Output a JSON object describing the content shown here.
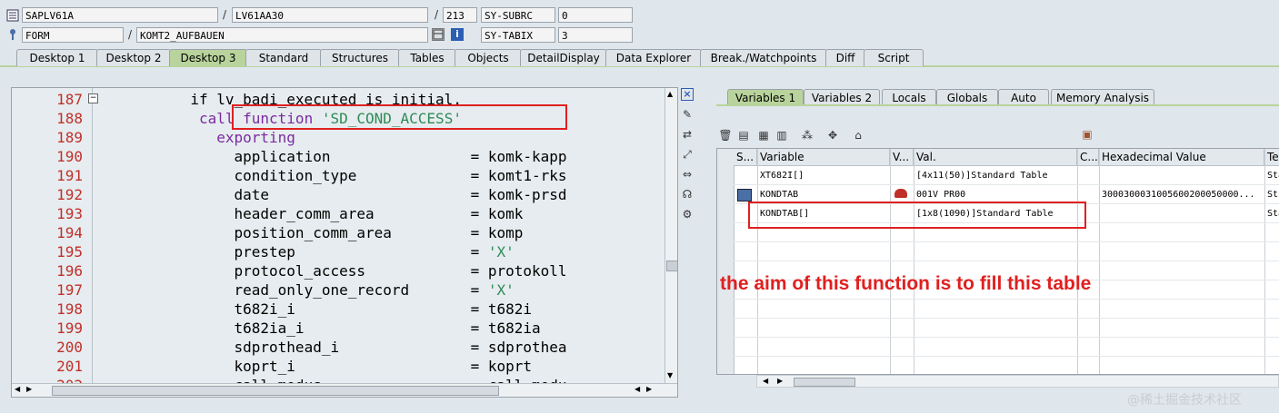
{
  "header": {
    "program": "SAPLV61A",
    "include": "LV61AA30",
    "line": "213",
    "subrc_label": "SY-SUBRC",
    "subrc_value": "0",
    "event_type": "FORM",
    "event_name": "KOMT2_AUFBAUEN",
    "tabix_label": "SY-TABIX",
    "tabix_value": "3",
    "sep": "/"
  },
  "tabs": [
    "Desktop 1",
    "Desktop 2",
    "Desktop 3",
    "Standard",
    "Structures",
    "Tables",
    "Objects",
    "DetailDisplay",
    "Data Explorer",
    "Break./Watchpoints",
    "Diff",
    "Script"
  ],
  "active_tab": "Desktop 3",
  "code": [
    {
      "n": "187",
      "indent": "          ",
      "parts": [
        [
          "",
          "if lv_badi_executed is initial."
        ]
      ]
    },
    {
      "n": "188",
      "indent": "           ",
      "parts": [
        [
          "kw",
          "call function "
        ],
        [
          "str",
          "'SD_COND_ACCESS'"
        ]
      ]
    },
    {
      "n": "189",
      "indent": "             ",
      "parts": [
        [
          "kw",
          "exporting"
        ]
      ]
    },
    {
      "n": "190",
      "indent": "               ",
      "parts": [
        [
          "",
          "application                = komk-kapp"
        ]
      ]
    },
    {
      "n": "191",
      "indent": "               ",
      "parts": [
        [
          "",
          "condition_type             = komt1-rks"
        ]
      ]
    },
    {
      "n": "192",
      "indent": "               ",
      "parts": [
        [
          "",
          "date                       = komk-prsd"
        ]
      ]
    },
    {
      "n": "193",
      "indent": "               ",
      "parts": [
        [
          "",
          "header_comm_area           = komk"
        ]
      ]
    },
    {
      "n": "194",
      "indent": "               ",
      "parts": [
        [
          "",
          "position_comm_area         = komp"
        ]
      ]
    },
    {
      "n": "195",
      "indent": "               ",
      "parts": [
        [
          "",
          "prestep                    = "
        ],
        [
          "str",
          "'X'"
        ]
      ]
    },
    {
      "n": "196",
      "indent": "               ",
      "parts": [
        [
          "",
          "protocol_access            = protokoll"
        ]
      ]
    },
    {
      "n": "197",
      "indent": "               ",
      "parts": [
        [
          "",
          "read_only_one_record       = "
        ],
        [
          "str",
          "'X'"
        ]
      ]
    },
    {
      "n": "198",
      "indent": "               ",
      "parts": [
        [
          "",
          "t682i_i                    = t682i"
        ]
      ]
    },
    {
      "n": "199",
      "indent": "               ",
      "parts": [
        [
          "",
          "t682ia_i                   = t682ia"
        ]
      ]
    },
    {
      "n": "200",
      "indent": "               ",
      "parts": [
        [
          "",
          "sdprothead_i               = sdprothea"
        ]
      ]
    },
    {
      "n": "201",
      "indent": "               ",
      "parts": [
        [
          "",
          "koprt_i                    = koprt"
        ]
      ]
    },
    {
      "n": "202",
      "indent": "               ",
      "parts": [
        [
          "",
          "call_modus                 = call_modu"
        ]
      ]
    }
  ],
  "right_tabs": [
    "Variables 1",
    "Variables 2",
    "Locals",
    "Globals",
    "Auto",
    "Memory Analysis"
  ],
  "right_active_tab": "Variables 1",
  "grid": {
    "headers": [
      "S...",
      "Variable",
      "V...",
      "Val.",
      "C...",
      "Hexadecimal Value",
      "Te"
    ],
    "rows": [
      {
        "variable": "XT682I[]",
        "val": "[4x11(50)]Standard Table",
        "hex": "",
        "te": "Sta"
      },
      {
        "variable": "KONDTAB",
        "val": "001V PR00",
        "hex": "3000300031005600200050000...",
        "te": "Str"
      },
      {
        "variable": "KONDTAB[]",
        "val": "[1x8(1090)]Standard Table",
        "hex": "",
        "te": "Sta"
      }
    ]
  },
  "annotation": "the aim of this function is to fill this table",
  "watermark": "@稀土掘金技术社区",
  "colors": {
    "accent_green": "#b9d39c",
    "annotation_red": "#e02020",
    "keyword": "#7b2aa0",
    "string": "#2e8b57",
    "line_number": "#c0302a"
  }
}
